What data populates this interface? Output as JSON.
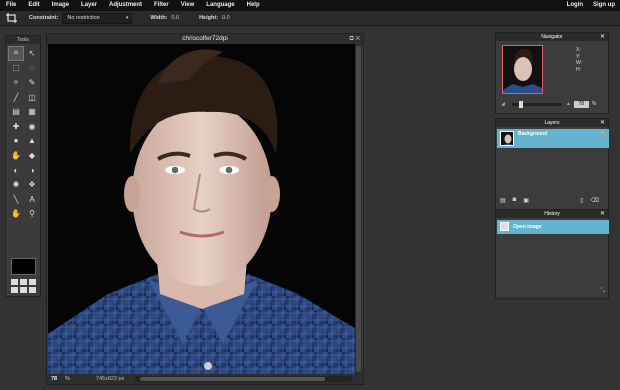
{
  "menu": {
    "items": [
      "File",
      "Edit",
      "Image",
      "Layer",
      "Adjustment",
      "Filter",
      "View",
      "Language",
      "Help"
    ],
    "login": "Login",
    "signup": "Sign up"
  },
  "options": {
    "constraint_label": "Constraint:",
    "constraint_value": "No restriction",
    "width_label": "Width:",
    "width_value": "0.0",
    "height_label": "Height:",
    "height_value": "0.0"
  },
  "tools": {
    "title": "Tools",
    "icons": [
      "crop-icon",
      "move-icon",
      "marquee-icon",
      "lasso-icon",
      "wand-icon",
      "pencil-icon",
      "brush-icon",
      "eraser-icon",
      "bucket-icon",
      "gradient-icon",
      "clone-icon",
      "red-eye-icon",
      "drop-icon",
      "sharpen-icon",
      "smudge-icon",
      "sponge-icon",
      "dodge-icon",
      "burn-icon",
      "bloat-icon",
      "pinch-icon",
      "picker-icon",
      "type-icon",
      "hand-icon",
      "zoom-icon"
    ],
    "glyphs": [
      "⌗",
      "↖",
      "⬚",
      "◌",
      "✧",
      "✎",
      "╱",
      "◫",
      "▤",
      "▦",
      "✚",
      "◉",
      "●",
      "▲",
      "✋",
      "◆",
      "◐",
      "◑",
      "✺",
      "❖",
      "╲",
      "A",
      "✋",
      "⚲"
    ]
  },
  "document": {
    "title": "chriscolfer72dpi",
    "zoom": "78",
    "zoom_unit": "%",
    "size": "745x823 px"
  },
  "navigator": {
    "title": "Navigator",
    "x_label": "X:",
    "y_label": "Y:",
    "w_label": "W:",
    "h_label": "H:",
    "zoom_value": "78",
    "zoom_unit": "%"
  },
  "layers": {
    "title": "Layers",
    "items": [
      {
        "name": "Background"
      }
    ]
  },
  "history": {
    "title": "History",
    "items": [
      {
        "name": "Open image"
      }
    ]
  }
}
